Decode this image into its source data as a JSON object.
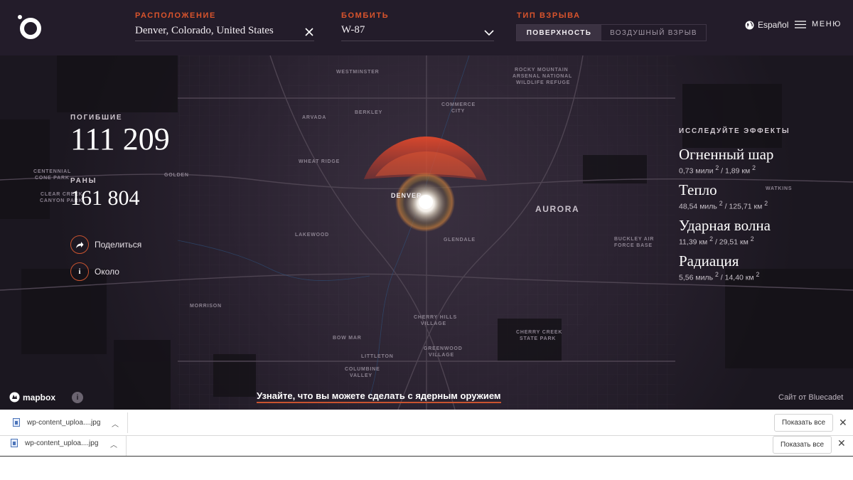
{
  "header": {
    "location_label": "РАСПОЛОЖЕНИЕ",
    "location_value": "Denver, Colorado, United States",
    "bomb_label": "БОМБИТЬ",
    "bomb_value": "W-87",
    "burst_label": "ТИП ВЗРЫВА",
    "burst_options": [
      "ПОВЕРХНОСТЬ",
      "ВОЗДУШНЫЙ ВЗРЫВ"
    ],
    "burst_selected": "ПОВЕРХНОСТЬ",
    "language": "Español",
    "menu_label": "МЕНЮ"
  },
  "stats": {
    "deaths_label": "ПОГИБШИЕ",
    "deaths_value": "111 209",
    "injuries_label": "РАНЫ",
    "injuries_value": "161 804",
    "share_label": "Поделиться",
    "about_label": "Около"
  },
  "effects": {
    "title": "ИССЛЕДУЙТЕ ЭФФЕКТЫ",
    "items": [
      {
        "name": "Огненный шар",
        "a": "0,73 мили",
        "b": "1,89 км"
      },
      {
        "name": "Тепло",
        "a": "48,54 миль",
        "b": "125,71 км"
      },
      {
        "name": "Ударная волна",
        "a": "11,39 км",
        "b": "29,51 км"
      },
      {
        "name": "Радиация",
        "a": "5,56 миль",
        "b": "14,40 км"
      }
    ],
    "sup": "2"
  },
  "map": {
    "labels": {
      "westminster": "WESTMINSTER",
      "rocky1": "ROCKY MOUNTAIN",
      "rocky2": "ARSENAL NATIONAL",
      "rocky3": "WILDLIFE REFUGE",
      "commerce1": "COMMERCE",
      "commerce2": "CITY",
      "arvada": "ARVADA",
      "berkley": "BERKLEY",
      "wheatridge": "WHEAT RIDGE",
      "golden": "GOLDEN",
      "centennial1": "CENTENNIAL",
      "centennial2": "CONE PARK",
      "clearcreek1": "CLEAR CREEK",
      "clearcreek2": "CANYON PARK",
      "denver": "DENVER",
      "aurora": "AURORA",
      "lakewood": "LAKEWOOD",
      "glendale": "GLENDALE",
      "buckley1": "BUCKLEY AIR",
      "buckley2": "FORCE BASE",
      "watkins": "WATKINS",
      "morrison": "MORRISON",
      "cherryhills1": "CHERRY HILLS",
      "cherryhills2": "VILLAGE",
      "bowmar": "BOW MAR",
      "littleton": "LITTLETON",
      "greenwood1": "GREENWOOD",
      "greenwood2": "VILLAGE",
      "columbine1": "COLUMBINE",
      "columbine2": "VALLEY",
      "cherrycreek1": "CHERRY CREEK",
      "cherrycreek2": "STATE PARK"
    }
  },
  "footer": {
    "mapbox": "mapbox",
    "info": "i",
    "learn_more": "Узнайте, что вы можете сделать с ядерным оружием",
    "credit": "Сайт от Bluecadet"
  },
  "downloads": {
    "file_name": "wp-content_uploa....jpg",
    "show_all": "Показать все",
    "close": "✕"
  },
  "colors": {
    "accent": "#d9542c",
    "background": "#1b1720",
    "header": "#231c2a"
  }
}
